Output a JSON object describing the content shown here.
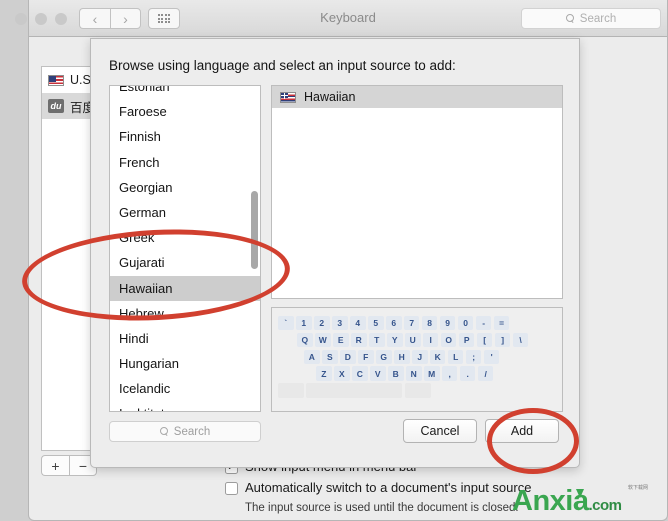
{
  "window": {
    "title": "Keyboard",
    "search_placeholder": "Search",
    "traffic_lights": [
      "close",
      "minimize",
      "zoom"
    ],
    "nav_back": "‹",
    "nav_forward": "›"
  },
  "input_sources": {
    "items": [
      {
        "flag": "us-flag-icon",
        "label": "U.S.",
        "selected": false
      },
      {
        "flag": "baidu-badge-icon",
        "badge": "du",
        "label": "百度",
        "selected": true
      }
    ],
    "add_button": "+",
    "remove_button": "−"
  },
  "options": {
    "show_input_menu": {
      "label": "Show input menu in menu bar",
      "checked": true
    },
    "auto_switch": {
      "label": "Automatically switch to a document's input source",
      "checked": false,
      "sublabel": "The input source is used until the document is closed."
    }
  },
  "sheet": {
    "title": "Browse using language and select an input source to add:",
    "search_placeholder": "Search",
    "cancel_label": "Cancel",
    "add_label": "Add",
    "languages": [
      {
        "name": "Estonian",
        "selected": false
      },
      {
        "name": "Faroese",
        "selected": false
      },
      {
        "name": "Finnish",
        "selected": false
      },
      {
        "name": "French",
        "selected": false
      },
      {
        "name": "Georgian",
        "selected": false
      },
      {
        "name": "German",
        "selected": false
      },
      {
        "name": "Greek",
        "selected": false
      },
      {
        "name": "Gujarati",
        "selected": false
      },
      {
        "name": "Hawaiian",
        "selected": true
      },
      {
        "name": "Hebrew",
        "selected": false
      },
      {
        "name": "Hindi",
        "selected": false
      },
      {
        "name": "Hungarian",
        "selected": false
      },
      {
        "name": "Icelandic",
        "selected": false
      },
      {
        "name": "Inuktitut",
        "selected": false
      }
    ],
    "input_sources": [
      {
        "flag": "hawaii-flag-icon",
        "label": "Hawaiian",
        "selected": true
      }
    ],
    "keyboard_preview": {
      "rows": [
        [
          "`",
          "1",
          "2",
          "3",
          "4",
          "5",
          "6",
          "7",
          "8",
          "9",
          "0",
          "-",
          "="
        ],
        [
          "Q",
          "W",
          "E",
          "R",
          "T",
          "Y",
          "U",
          "I",
          "O",
          "P",
          "[",
          "]",
          "\\"
        ],
        [
          "A",
          "S",
          "D",
          "F",
          "G",
          "H",
          "J",
          "K",
          "L",
          ";",
          "'"
        ],
        [
          "Z",
          "X",
          "C",
          "V",
          "B",
          "N",
          "M",
          ",",
          ".",
          "/"
        ]
      ]
    }
  },
  "annotations": {
    "ellipse_language": "highlight-hawaiian-language-row",
    "ellipse_add": "highlight-add-button"
  },
  "watermark": {
    "brand": "Anxia",
    "tld": ".com",
    "sub": "软下载网"
  },
  "colors": {
    "annotation_red": "#d1402f",
    "selection_gray": "#cdcdcd",
    "key_blue": "#35548c",
    "watermark_green": "#3aa650"
  }
}
